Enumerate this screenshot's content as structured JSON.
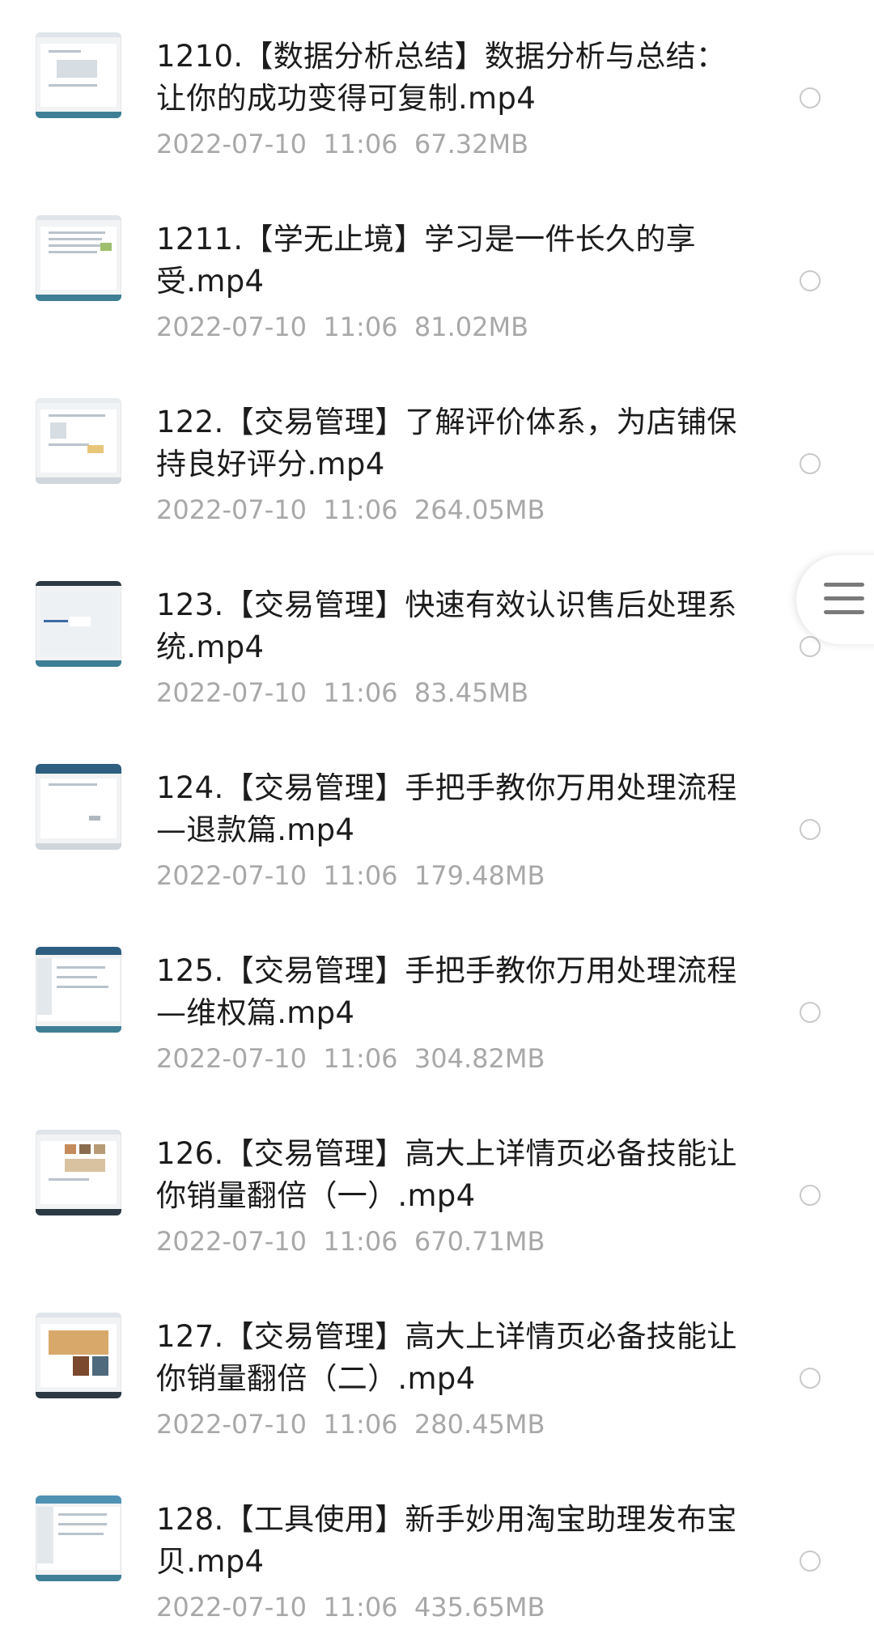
{
  "files": [
    {
      "title": "1210.【数据分析总结】数据分析与总结：让你的成功变得可复制.mp4",
      "date": "2022-07-10",
      "time": "11:06",
      "size": "67.32MB",
      "thumb_icon": "video-thumbnail-icon"
    },
    {
      "title": "1211.【学无止境】学习是一件长久的享受.mp4",
      "date": "2022-07-10",
      "time": "11:06",
      "size": "81.02MB",
      "thumb_icon": "video-thumbnail-icon"
    },
    {
      "title": "122.【交易管理】了解评价体系，为店铺保持良好评分.mp4",
      "date": "2022-07-10",
      "time": "11:06",
      "size": "264.05MB",
      "thumb_icon": "video-thumbnail-icon"
    },
    {
      "title": "123.【交易管理】快速有效认识售后处理系统.mp4",
      "date": "2022-07-10",
      "time": "11:06",
      "size": "83.45MB",
      "thumb_icon": "video-thumbnail-icon"
    },
    {
      "title": "124.【交易管理】手把手教你万用处理流程—退款篇.mp4",
      "date": "2022-07-10",
      "time": "11:06",
      "size": "179.48MB",
      "thumb_icon": "video-thumbnail-icon"
    },
    {
      "title": "125.【交易管理】手把手教你万用处理流程—维权篇.mp4",
      "date": "2022-07-10",
      "time": "11:06",
      "size": "304.82MB",
      "thumb_icon": "video-thumbnail-icon"
    },
    {
      "title": "126.【交易管理】高大上详情页必备技能让你销量翻倍（一）.mp4",
      "date": "2022-07-10",
      "time": "11:06",
      "size": "670.71MB",
      "thumb_icon": "video-thumbnail-icon"
    },
    {
      "title": "127.【交易管理】高大上详情页必备技能让你销量翻倍（二）.mp4",
      "date": "2022-07-10",
      "time": "11:06",
      "size": "280.45MB",
      "thumb_icon": "video-thumbnail-icon"
    },
    {
      "title": "128.【工具使用】新手妙用淘宝助理发布宝贝.mp4",
      "date": "2022-07-10",
      "time": "11:06",
      "size": "435.65MB",
      "thumb_icon": "video-thumbnail-icon"
    }
  ],
  "side_menu": {
    "icon": "hamburger-menu-icon"
  },
  "colors": {
    "title": "#1c1c1c",
    "meta": "#a8a8a8",
    "radio_border": "#c9c9c9",
    "thumb_accent": "#2e6f8e",
    "thumb_dark": "#2b3a44"
  }
}
